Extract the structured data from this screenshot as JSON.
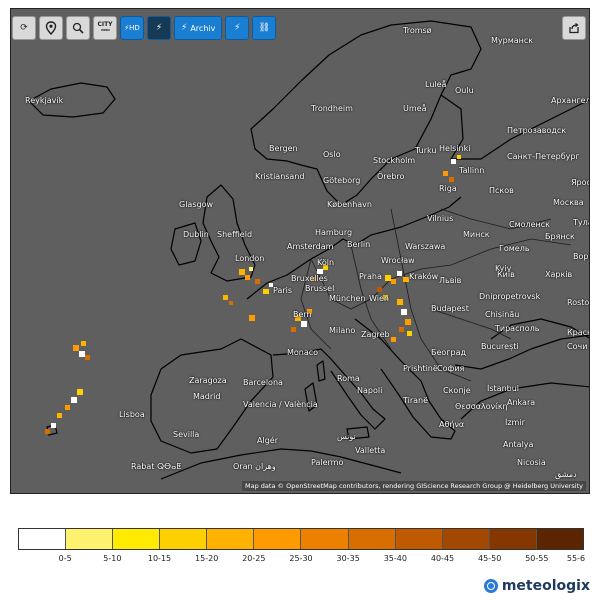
{
  "toolbar": {
    "city_label": "CITY",
    "hd_label": "HD",
    "archive_label": "Archiv"
  },
  "map": {
    "attribution": "Map data © OpenStreetMap contributors, rendering GIScience Research Group @ Heidelberg University",
    "cities": [
      {
        "name": "Reykjavík"
      },
      {
        "name": "Tromsø"
      },
      {
        "name": "Мурманск"
      },
      {
        "name": "Luleå"
      },
      {
        "name": "Oulu"
      },
      {
        "name": "Архангельск"
      },
      {
        "name": "Trondheim"
      },
      {
        "name": "Umeå"
      },
      {
        "name": "Петрозаводск"
      },
      {
        "name": "Bergen"
      },
      {
        "name": "Oslo"
      },
      {
        "name": "Turku"
      },
      {
        "name": "Helsinki"
      },
      {
        "name": "Stockholm"
      },
      {
        "name": "Санкт-Петербург"
      },
      {
        "name": "Kristiansand"
      },
      {
        "name": "Göteborg"
      },
      {
        "name": "Örebro"
      },
      {
        "name": "Tallinn"
      },
      {
        "name": "Псков"
      },
      {
        "name": "Яросл"
      },
      {
        "name": "Glasgow"
      },
      {
        "name": "København"
      },
      {
        "name": "Riga"
      },
      {
        "name": "Москва"
      },
      {
        "name": "Vilnius"
      },
      {
        "name": "Смоленск"
      },
      {
        "name": "Тула"
      },
      {
        "name": "Dublin"
      },
      {
        "name": "Sheffield"
      },
      {
        "name": "Hamburg"
      },
      {
        "name": "Berlin"
      },
      {
        "name": "Минск"
      },
      {
        "name": "Брянск"
      },
      {
        "name": "Amsterdam"
      },
      {
        "name": "Warszawa"
      },
      {
        "name": "Гомель"
      },
      {
        "name": "Ворон"
      },
      {
        "name": "London"
      },
      {
        "name": "Köln"
      },
      {
        "name": "Kyiv"
      },
      {
        "name": "Київ"
      },
      {
        "name": "Харків"
      },
      {
        "name": "Bruxelles"
      },
      {
        "name": "Brussel"
      },
      {
        "name": "Wrocław"
      },
      {
        "name": "Kraków"
      },
      {
        "name": "Львів"
      },
      {
        "name": "Praha"
      },
      {
        "name": "Paris"
      },
      {
        "name": "Dnipropetrovsk"
      },
      {
        "name": "München"
      },
      {
        "name": "Wien"
      },
      {
        "name": "Rostov"
      },
      {
        "name": "Bern"
      },
      {
        "name": "Budapest"
      },
      {
        "name": "Chișinău"
      },
      {
        "name": "Milano"
      },
      {
        "name": "Zagreb"
      },
      {
        "name": "Тирасполь"
      },
      {
        "name": "Краснодар"
      },
      {
        "name": "Београд"
      },
      {
        "name": "București"
      },
      {
        "name": "Monaco"
      },
      {
        "name": "Сочи"
      },
      {
        "name": "Roma"
      },
      {
        "name": "Prishtinë"
      },
      {
        "name": "София"
      },
      {
        "name": "Zaragoza"
      },
      {
        "name": "Barcelona"
      },
      {
        "name": "Napoli"
      },
      {
        "name": "Скопје"
      },
      {
        "name": "İstanbul"
      },
      {
        "name": "Madrid"
      },
      {
        "name": "Valencia / València"
      },
      {
        "name": "Tiranë"
      },
      {
        "name": "Θεσσαλονίκη"
      },
      {
        "name": "Ankara"
      },
      {
        "name": "Lisboa"
      },
      {
        "name": "Sevilla"
      },
      {
        "name": "Αθήνα"
      },
      {
        "name": "İzmir"
      },
      {
        "name": "Algér"
      },
      {
        "name": "تونس"
      },
      {
        "name": "Palermo"
      },
      {
        "name": "Antalya"
      },
      {
        "name": "Rabat ⵕⴱⴰⵟ"
      },
      {
        "name": "Oran وهران"
      },
      {
        "name": "Valletta"
      },
      {
        "name": "Nicosia"
      },
      {
        "name": "دمشق"
      }
    ]
  },
  "legend": {
    "labels": [
      "0-5",
      "5-10",
      "10-15",
      "15-20",
      "20-25",
      "25-30",
      "30-35",
      "35-40",
      "40-45",
      "45-50",
      "50-55",
      "55-6"
    ],
    "colors": [
      "#ffffff",
      "#fff270",
      "#ffea00",
      "#ffd000",
      "#ffb300",
      "#ff9a00",
      "#ec8000",
      "#d86e00",
      "#c05a00",
      "#a34800",
      "#843800",
      "#5a2500"
    ]
  },
  "brand": {
    "name": "meteologix"
  }
}
